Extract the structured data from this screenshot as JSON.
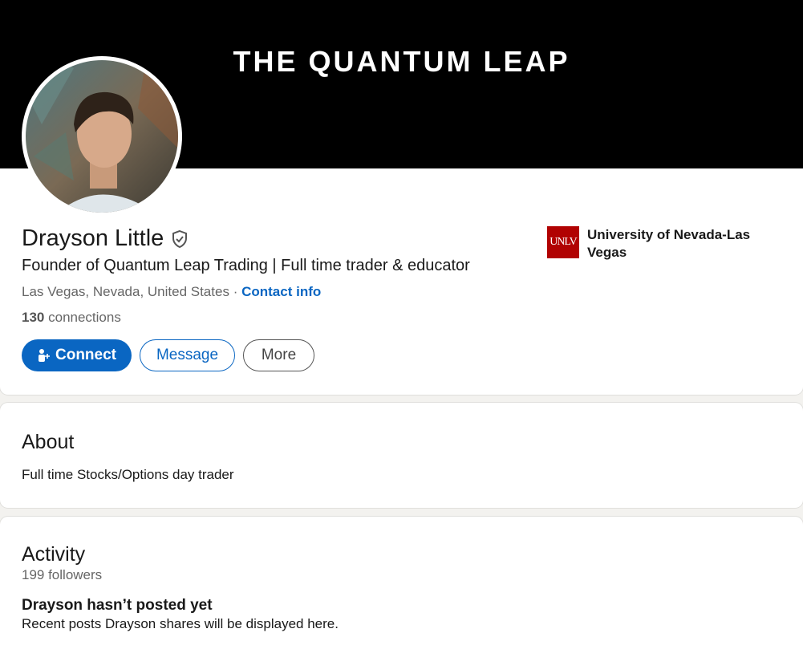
{
  "banner": {
    "text": "THE QUANTUM LEAP"
  },
  "profile": {
    "name": "Drayson Little",
    "headline": "Founder of Quantum Leap Trading | Full time trader & educator",
    "location": "Las Vegas, Nevada, United States",
    "separator": "·",
    "contact_info": "Contact info",
    "connections_count": "130",
    "connections_label": "connections"
  },
  "actions": {
    "connect": "Connect",
    "message": "Message",
    "more": "More"
  },
  "education": {
    "logo_text": "UNLV",
    "school": "University of Nevada-Las Vegas"
  },
  "about": {
    "title": "About",
    "text": "Full time Stocks/Options day trader"
  },
  "activity": {
    "title": "Activity",
    "followers": "199 followers",
    "empty_title": "Drayson hasn’t posted yet",
    "empty_text": "Recent posts Drayson shares will be displayed here."
  },
  "colors": {
    "primary": "#0a66c2",
    "banner": "#000000",
    "unlv_red": "#b10202"
  }
}
